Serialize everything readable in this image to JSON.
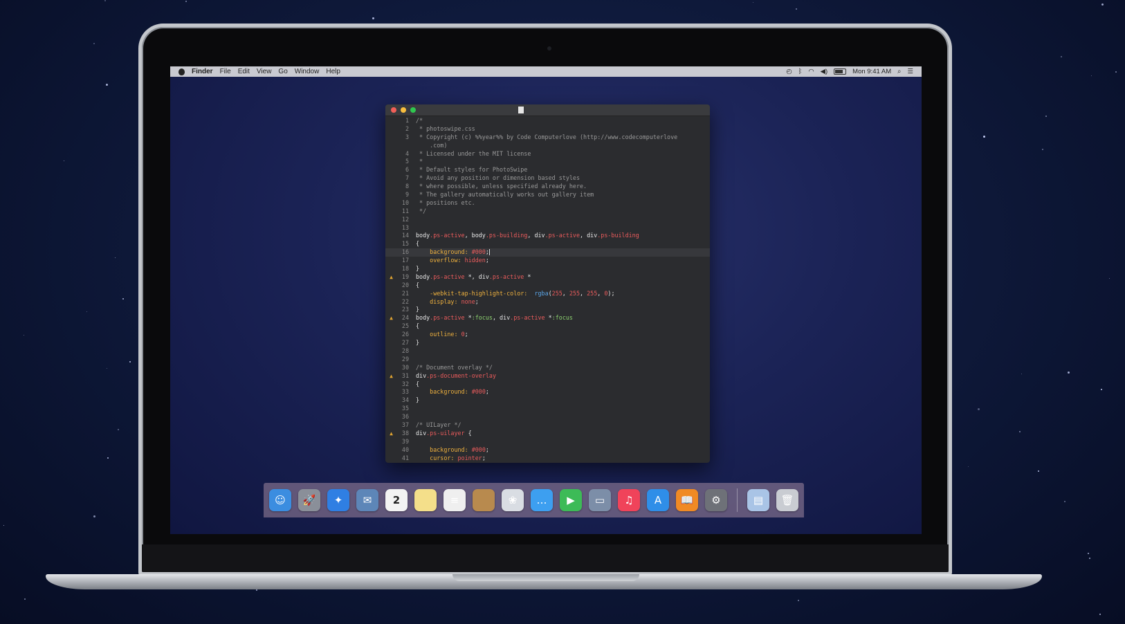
{
  "menubar": {
    "app_name": "Finder",
    "items": [
      "File",
      "Edit",
      "View",
      "Go",
      "Window",
      "Help"
    ],
    "clock": "Mon 9:41 AM"
  },
  "editor": {
    "lines": [
      {
        "n": "1",
        "warn": false,
        "hl": false,
        "tokens": [
          [
            "c",
            "/*"
          ]
        ]
      },
      {
        "n": "2",
        "warn": false,
        "hl": false,
        "tokens": [
          [
            "c",
            " * photoswipe.css"
          ]
        ]
      },
      {
        "n": "3",
        "warn": false,
        "hl": false,
        "tokens": [
          [
            "c",
            " * Copyright (c) %%year%% by Code Computerlove (http://www.codecomputerlove"
          ]
        ]
      },
      {
        "n": "",
        "warn": false,
        "hl": false,
        "tokens": [
          [
            "c",
            "    .com)"
          ]
        ]
      },
      {
        "n": "4",
        "warn": false,
        "hl": false,
        "tokens": [
          [
            "c",
            " * Licensed under the MIT license"
          ]
        ]
      },
      {
        "n": "5",
        "warn": false,
        "hl": false,
        "tokens": [
          [
            "c",
            " *"
          ]
        ]
      },
      {
        "n": "6",
        "warn": false,
        "hl": false,
        "tokens": [
          [
            "c",
            " * Default styles for PhotoSwipe"
          ]
        ]
      },
      {
        "n": "7",
        "warn": false,
        "hl": false,
        "tokens": [
          [
            "c",
            " * Avoid any position or dimension based styles"
          ]
        ]
      },
      {
        "n": "8",
        "warn": false,
        "hl": false,
        "tokens": [
          [
            "c",
            " * where possible, unless specified already here."
          ]
        ]
      },
      {
        "n": "9",
        "warn": false,
        "hl": false,
        "tokens": [
          [
            "c",
            " * The gallery automatically works out gallery item"
          ]
        ]
      },
      {
        "n": "10",
        "warn": false,
        "hl": false,
        "tokens": [
          [
            "c",
            " * positions etc."
          ]
        ]
      },
      {
        "n": "11",
        "warn": false,
        "hl": false,
        "tokens": [
          [
            "c",
            " */"
          ]
        ]
      },
      {
        "n": "12",
        "warn": false,
        "hl": false,
        "tokens": []
      },
      {
        "n": "13",
        "warn": false,
        "hl": false,
        "tokens": []
      },
      {
        "n": "14",
        "warn": false,
        "hl": false,
        "tokens": [
          [
            "t",
            "body"
          ],
          [
            "k",
            ".ps-active"
          ],
          [
            "t",
            ", body"
          ],
          [
            "k",
            ".ps-building"
          ],
          [
            "t",
            ", div"
          ],
          [
            "k",
            ".ps-active"
          ],
          [
            "t",
            ", div"
          ],
          [
            "k",
            ".ps-building"
          ]
        ]
      },
      {
        "n": "15",
        "warn": false,
        "hl": false,
        "tokens": [
          [
            "t",
            "{"
          ]
        ]
      },
      {
        "n": "16",
        "warn": false,
        "hl": true,
        "tokens": [
          [
            "p",
            "    background: "
          ],
          [
            "v",
            "#000"
          ],
          [
            "t",
            ";"
          ],
          [
            "caret",
            ""
          ]
        ]
      },
      {
        "n": "17",
        "warn": false,
        "hl": false,
        "tokens": [
          [
            "p",
            "    overflow: "
          ],
          [
            "v",
            "hidden"
          ],
          [
            "t",
            ";"
          ]
        ]
      },
      {
        "n": "18",
        "warn": false,
        "hl": false,
        "tokens": [
          [
            "t",
            "}"
          ]
        ]
      },
      {
        "n": "19",
        "warn": true,
        "hl": false,
        "tokens": [
          [
            "t",
            "body"
          ],
          [
            "k",
            ".ps-active"
          ],
          [
            "t",
            " *, div"
          ],
          [
            "k",
            ".ps-active"
          ],
          [
            "t",
            " *"
          ]
        ]
      },
      {
        "n": "20",
        "warn": false,
        "hl": false,
        "tokens": [
          [
            "t",
            "{"
          ]
        ]
      },
      {
        "n": "21",
        "warn": false,
        "hl": false,
        "tokens": [
          [
            "p",
            "    -webkit-tap-highlight-color:  "
          ],
          [
            "f",
            "rgba"
          ],
          [
            "t",
            "("
          ],
          [
            "v",
            "255"
          ],
          [
            "t",
            ", "
          ],
          [
            "v",
            "255"
          ],
          [
            "t",
            ", "
          ],
          [
            "v",
            "255"
          ],
          [
            "t",
            ", "
          ],
          [
            "v",
            "0"
          ],
          [
            "t",
            ");"
          ]
        ]
      },
      {
        "n": "22",
        "warn": false,
        "hl": false,
        "tokens": [
          [
            "p",
            "    display: "
          ],
          [
            "v",
            "none"
          ],
          [
            "t",
            ";"
          ]
        ]
      },
      {
        "n": "23",
        "warn": false,
        "hl": false,
        "tokens": [
          [
            "t",
            "}"
          ]
        ]
      },
      {
        "n": "24",
        "warn": true,
        "hl": false,
        "tokens": [
          [
            "t",
            "body"
          ],
          [
            "k",
            ".ps-active"
          ],
          [
            "t",
            " *"
          ],
          [
            "g",
            ":focus"
          ],
          [
            "t",
            ", div"
          ],
          [
            "k",
            ".ps-active"
          ],
          [
            "t",
            " *"
          ],
          [
            "g",
            ":focus"
          ]
        ]
      },
      {
        "n": "25",
        "warn": false,
        "hl": false,
        "tokens": [
          [
            "t",
            "{"
          ]
        ]
      },
      {
        "n": "26",
        "warn": false,
        "hl": false,
        "tokens": [
          [
            "p",
            "    outline: "
          ],
          [
            "v",
            "0"
          ],
          [
            "t",
            ";"
          ]
        ]
      },
      {
        "n": "27",
        "warn": false,
        "hl": false,
        "tokens": [
          [
            "t",
            "}"
          ]
        ]
      },
      {
        "n": "28",
        "warn": false,
        "hl": false,
        "tokens": []
      },
      {
        "n": "29",
        "warn": false,
        "hl": false,
        "tokens": []
      },
      {
        "n": "30",
        "warn": false,
        "hl": false,
        "tokens": [
          [
            "c",
            "/* Document overlay */"
          ]
        ]
      },
      {
        "n": "31",
        "warn": true,
        "hl": false,
        "tokens": [
          [
            "t",
            "div"
          ],
          [
            "k",
            ".ps-document-overlay"
          ]
        ]
      },
      {
        "n": "32",
        "warn": false,
        "hl": false,
        "tokens": [
          [
            "t",
            "{"
          ]
        ]
      },
      {
        "n": "33",
        "warn": false,
        "hl": false,
        "tokens": [
          [
            "p",
            "    background: "
          ],
          [
            "v",
            "#000"
          ],
          [
            "t",
            ";"
          ]
        ]
      },
      {
        "n": "34",
        "warn": false,
        "hl": false,
        "tokens": [
          [
            "t",
            "}"
          ]
        ]
      },
      {
        "n": "35",
        "warn": false,
        "hl": false,
        "tokens": []
      },
      {
        "n": "36",
        "warn": false,
        "hl": false,
        "tokens": []
      },
      {
        "n": "37",
        "warn": false,
        "hl": false,
        "tokens": [
          [
            "c",
            "/* UILayer */"
          ]
        ]
      },
      {
        "n": "38",
        "warn": true,
        "hl": false,
        "tokens": [
          [
            "t",
            "div"
          ],
          [
            "k",
            ".ps-uilayer"
          ],
          [
            "t",
            " {"
          ]
        ]
      },
      {
        "n": "39",
        "warn": false,
        "hl": false,
        "tokens": []
      },
      {
        "n": "40",
        "warn": false,
        "hl": false,
        "tokens": [
          [
            "p",
            "    background: "
          ],
          [
            "v",
            "#000"
          ],
          [
            "t",
            ";"
          ]
        ]
      },
      {
        "n": "41",
        "warn": false,
        "hl": false,
        "tokens": [
          [
            "p",
            "    cursor: "
          ],
          [
            "v",
            "pointer"
          ],
          [
            "t",
            ";"
          ]
        ]
      }
    ]
  },
  "dock": {
    "items": [
      {
        "name": "finder-icon",
        "glyph": "☺",
        "color": "#3b8de0"
      },
      {
        "name": "launchpad-icon",
        "glyph": "🚀",
        "color": "#8a8f99"
      },
      {
        "name": "safari-icon",
        "glyph": "✦",
        "color": "#2f7fe3"
      },
      {
        "name": "mail-icon",
        "glyph": "✉",
        "color": "#5d86b8"
      },
      {
        "name": "calendar-icon",
        "glyph": "2",
        "color": "#f3f3f3"
      },
      {
        "name": "notes-icon",
        "glyph": "",
        "color": "#f4df8a"
      },
      {
        "name": "reminders-icon",
        "glyph": "≡",
        "color": "#efefef"
      },
      {
        "name": "contacts-icon",
        "glyph": "",
        "color": "#b88a4e"
      },
      {
        "name": "photos-icon",
        "glyph": "❀",
        "color": "#d9dde3"
      },
      {
        "name": "messages-icon",
        "glyph": "…",
        "color": "#3d9ff0"
      },
      {
        "name": "facetime-icon",
        "glyph": "▶",
        "color": "#3dbb57"
      },
      {
        "name": "image-capture-icon",
        "glyph": "▭",
        "color": "#7c8ea8"
      },
      {
        "name": "itunes-icon",
        "glyph": "♫",
        "color": "#f0435a"
      },
      {
        "name": "app-store-icon",
        "glyph": "A",
        "color": "#2f8ee8"
      },
      {
        "name": "ibooks-icon",
        "glyph": "📖",
        "color": "#f08a24"
      },
      {
        "name": "system-preferences-icon",
        "glyph": "⚙",
        "color": "#6e7178"
      }
    ],
    "after_separator": [
      {
        "name": "documents-folder-icon",
        "glyph": "▤",
        "color": "#a9c4e6"
      },
      {
        "name": "trash-icon",
        "glyph": "🗑",
        "color": "#c9ccd2"
      }
    ]
  }
}
